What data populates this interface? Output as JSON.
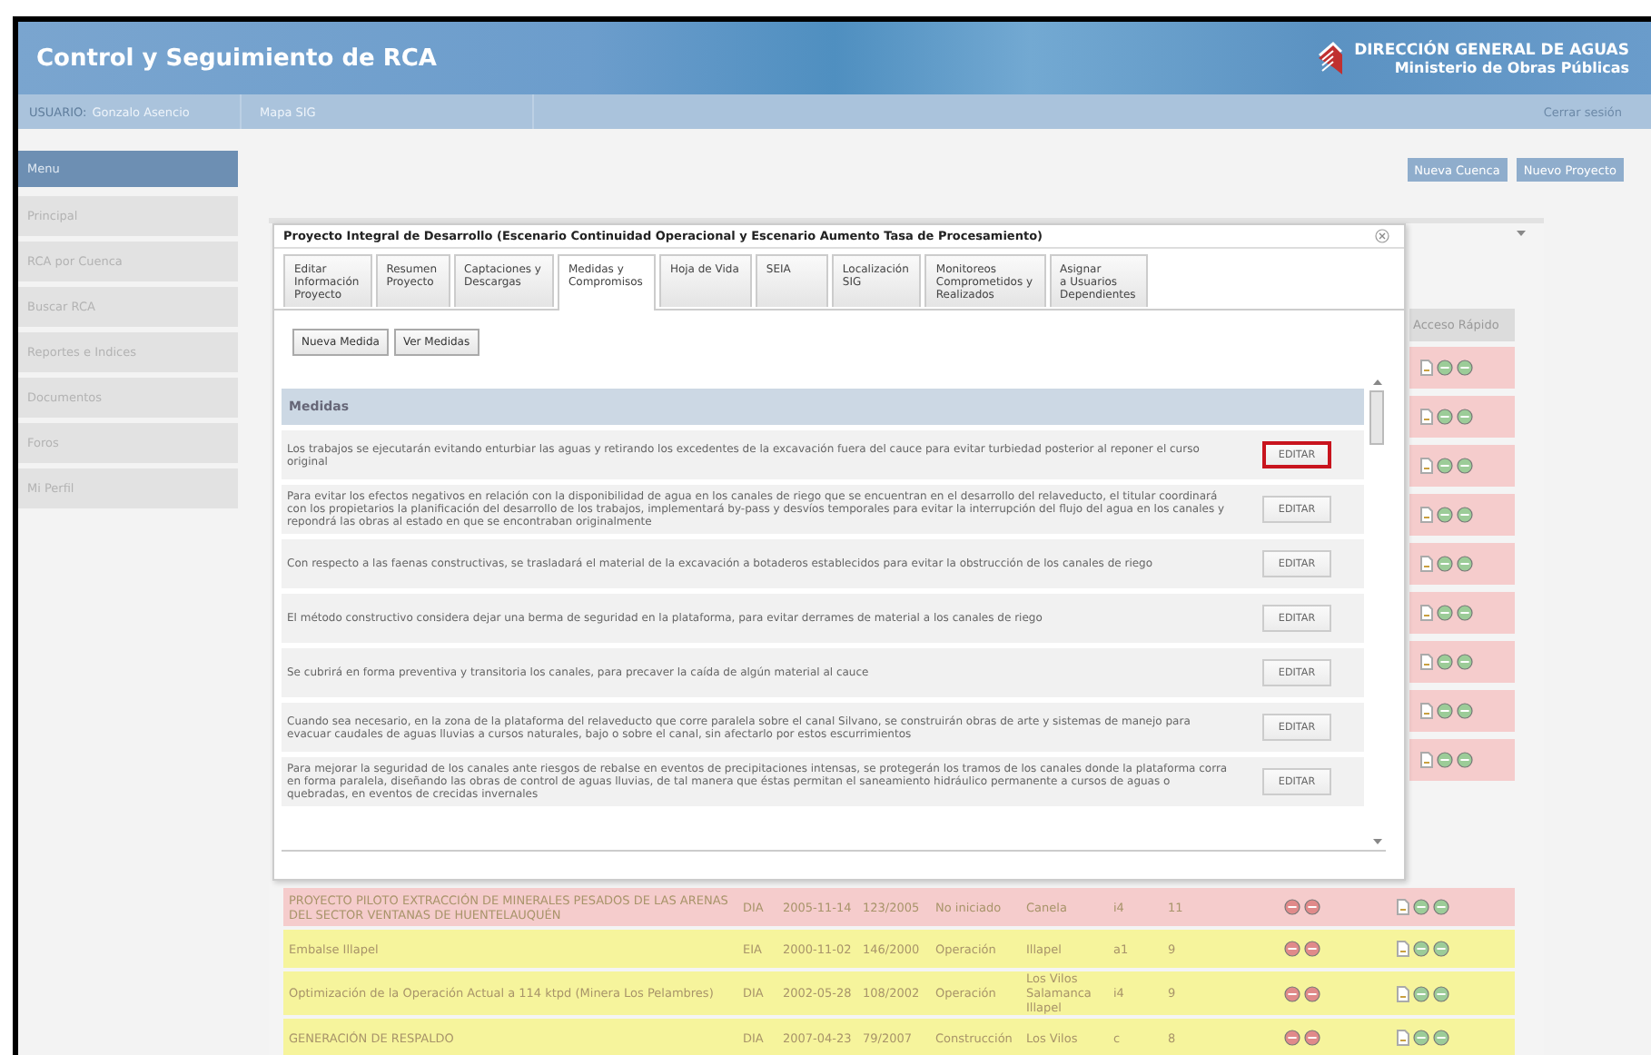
{
  "header": {
    "title": "Control y Seguimiento de RCA",
    "org": "DIRECCIÓN GENERAL DE AGUAS",
    "ministry": "Ministerio de Obras Públicas"
  },
  "user_bar": {
    "user_label": "USUARIO:",
    "user_name": "Gonzalo Asencio",
    "link": "Mapa SIG",
    "logout": "Cerrar sesión"
  },
  "sidebar": {
    "title": "Menu",
    "items": [
      "Principal",
      "RCA por Cuenca",
      "Buscar RCA",
      "Reportes e Indices",
      "Documentos",
      "Foros",
      "Mi Perfil"
    ]
  },
  "actions": [
    "Nueva Cuenca",
    "Nuevo Proyecto"
  ],
  "table": {
    "quick_access_header": "Acceso Rápido",
    "hidden_rows": [
      {
        "color": "#f5cccc"
      },
      {
        "color": "#f5cccc"
      },
      {
        "color": "#f5cccc"
      },
      {
        "color": "#f5cccc"
      },
      {
        "color": "#f5cccc"
      },
      {
        "color": "#f5cccc"
      },
      {
        "color": "#f5cccc"
      },
      {
        "color": "#f5cccc"
      },
      {
        "color": "#f5cccc"
      }
    ],
    "rows": [
      {
        "color": "#f5cccc",
        "cells": [
          "PROYECTO PILOTO EXTRACCIÓN DE MINERALES PESADOS DE LAS ARENAS DEL SECTOR VENTANAS DE HUENTELAUQUÉN",
          "DIA",
          "2005-11-14",
          "123/2005",
          "No iniciado",
          "Canela",
          "i4",
          "11"
        ]
      },
      {
        "color": "#f6f49c",
        "cells": [
          "Embalse Illapel",
          "EIA",
          "2000-11-02",
          "146/2000",
          "Operación",
          "Illapel",
          "a1",
          "9"
        ]
      },
      {
        "color": "#f6f49c",
        "cells": [
          "Optimización de la Operación Actual a 114 ktpd (Minera Los Pelambres)",
          "DIA",
          "2002-05-28",
          "108/2002",
          "Operación",
          "Los Vilos Salamanca Illapel",
          "i4",
          "9"
        ]
      },
      {
        "color": "#f6f49c",
        "cells": [
          "GENERACIÓN DE RESPALDO",
          "DIA",
          "2007-04-23",
          "79/2007",
          "Construcción",
          "Los Vilos",
          "c",
          "8"
        ]
      }
    ]
  },
  "modal": {
    "title": "Proyecto Integral de Desarrollo (Escenario Continuidad Operacional y Escenario Aumento Tasa de Procesamiento)",
    "tabs": [
      {
        "label": "Editar\nInformación\nProyecto",
        "selected": false
      },
      {
        "label": "Resumen\nProyecto",
        "selected": false
      },
      {
        "label": "Captaciones y\nDescargas",
        "selected": false
      },
      {
        "label": "Medidas y\nCompromisos",
        "selected": true
      },
      {
        "label": "Hoja de Vida",
        "selected": false
      },
      {
        "label": "SEIA",
        "selected": false
      },
      {
        "label": "Localización\nSIG",
        "selected": false
      },
      {
        "label": "Monitoreos\nComprometidos y\nRealizados",
        "selected": false
      },
      {
        "label": "Asignar\na Usuarios\nDependientes",
        "selected": false
      }
    ],
    "buttons": [
      "Nueva Medida",
      "Ver Medidas"
    ],
    "section_title": "Medidas",
    "measures": [
      {
        "text": "Los trabajos se ejecutarán evitando enturbiar las aguas y retirando los excedentes de la excavación fuera del cauce para evitar turbiedad posterior al reponer el curso original",
        "button": "EDITAR",
        "selected": true
      },
      {
        "text": "Para evitar los efectos negativos en relación con la disponibilidad de agua en los canales de riego que se encuentran en el desarrollo del relaveducto, el titular coordinará con los propietarios la planificación del desarrollo de los trabajos, implementará by-pass y desvíos temporales para evitar la interrupción del flujo del agua en los canales y repondrá las obras al estado en que se encontraban originalmente",
        "button": "EDITAR",
        "selected": false
      },
      {
        "text": "Con respecto a las faenas constructivas, se trasladará el material de la excavación a botaderos establecidos para evitar la obstrucción de los canales de riego",
        "button": "EDITAR",
        "selected": false
      },
      {
        "text": "El método constructivo considera dejar una berma de seguridad en la plataforma, para evitar derrames de material a los canales de riego",
        "button": "EDITAR",
        "selected": false
      },
      {
        "text": "Se cubrirá en forma preventiva y transitoria los canales, para precaver la caída de algún material al cauce",
        "button": "EDITAR",
        "selected": false
      },
      {
        "text": "Cuando sea necesario, en la zona de la plataforma del relaveducto que corre paralela sobre el canal Silvano, se construirán obras de arte y sistemas de manejo para evacuar caudales de aguas lluvias a cursos naturales, bajo o sobre el canal, sin afectarlo por estos escurrimientos",
        "button": "EDITAR",
        "selected": false
      },
      {
        "text": "Para mejorar la seguridad de los canales ante riesgos de rebalse en eventos de precipitaciones intensas, se protegerán los tramos de los canales donde la plataforma corra en forma paralela, diseñando las obras de control de aguas lluvias, de tal manera que éstas permitan el saneamiento hidráulico permanente a cursos de aguas o quebradas, en eventos de crecidas invernales",
        "button": "EDITAR",
        "selected": false
      }
    ]
  }
}
